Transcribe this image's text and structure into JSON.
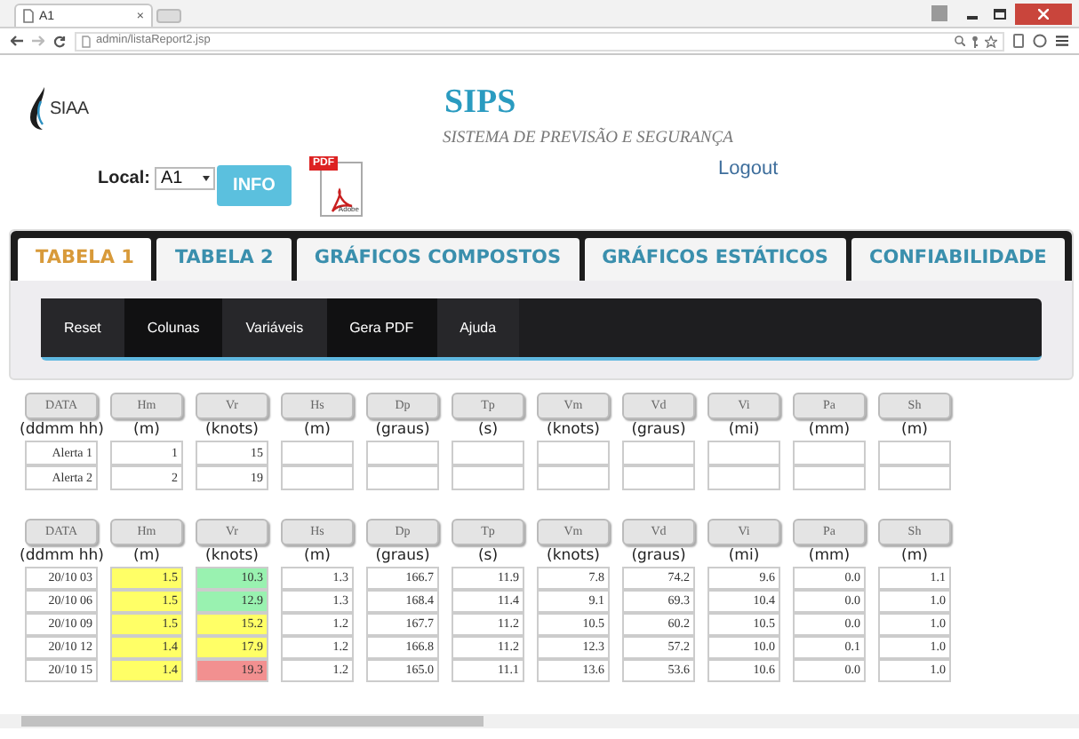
{
  "browser": {
    "tab_title": "A1",
    "tab_close": "×",
    "address": "admin/listaReport2.jsp"
  },
  "header": {
    "logo_text": "SIAA",
    "title": "SIPS",
    "subtitle": "SISTEMA DE PREVISÃO E SEGURANÇA",
    "logout": "Logout",
    "local_label": "Local:",
    "local_value": "A1",
    "info_button": "INFO",
    "pdf_label": "PDF",
    "pdf_brand": "Adobe"
  },
  "tabs": [
    {
      "label": "TABELA 1",
      "selected": true
    },
    {
      "label": "TABELA 2",
      "selected": false
    },
    {
      "label": "GRÁFICOS COMPOSTOS",
      "selected": false
    },
    {
      "label": "GRÁFICOS ESTÁTICOS",
      "selected": false
    },
    {
      "label": "CONFIABILIDADE",
      "selected": false
    }
  ],
  "menu": [
    "Reset",
    "Colunas",
    "Variáveis",
    "Gera PDF",
    "Ajuda"
  ],
  "tables": [
    {
      "columns": [
        {
          "name": "DATA",
          "unit": "(ddmm hh)"
        },
        {
          "name": "Hm",
          "unit": "(m)"
        },
        {
          "name": "Vr",
          "unit": "(knots)"
        },
        {
          "name": "Hs",
          "unit": "(m)"
        },
        {
          "name": "Dp",
          "unit": "(graus)"
        },
        {
          "name": "Tp",
          "unit": "(s)"
        },
        {
          "name": "Vm",
          "unit": "(knots)"
        },
        {
          "name": "Vd",
          "unit": "(graus)"
        },
        {
          "name": "Vi",
          "unit": "(mi)"
        },
        {
          "name": "Pa",
          "unit": "(mm)"
        },
        {
          "name": "Sh",
          "unit": "(m)"
        }
      ],
      "rows": [
        {
          "cells": [
            {
              "text": "Alerta 1"
            },
            {
              "text": "1"
            },
            {
              "text": "15"
            },
            {
              "text": ""
            },
            {
              "text": ""
            },
            {
              "text": ""
            },
            {
              "text": ""
            },
            {
              "text": ""
            },
            {
              "text": ""
            },
            {
              "text": ""
            },
            {
              "text": ""
            }
          ]
        },
        {
          "cells": [
            {
              "text": "Alerta 2"
            },
            {
              "text": "2"
            },
            {
              "text": "19"
            },
            {
              "text": ""
            },
            {
              "text": ""
            },
            {
              "text": ""
            },
            {
              "text": ""
            },
            {
              "text": ""
            },
            {
              "text": ""
            },
            {
              "text": ""
            },
            {
              "text": ""
            }
          ]
        }
      ]
    },
    {
      "columns": [
        {
          "name": "DATA",
          "unit": "(ddmm hh)"
        },
        {
          "name": "Hm",
          "unit": "(m)"
        },
        {
          "name": "Vr",
          "unit": "(knots)"
        },
        {
          "name": "Hs",
          "unit": "(m)"
        },
        {
          "name": "Dp",
          "unit": "(graus)"
        },
        {
          "name": "Tp",
          "unit": "(s)"
        },
        {
          "name": "Vm",
          "unit": "(knots)"
        },
        {
          "name": "Vd",
          "unit": "(graus)"
        },
        {
          "name": "Vi",
          "unit": "(mi)"
        },
        {
          "name": "Pa",
          "unit": "(mm)"
        },
        {
          "name": "Sh",
          "unit": "(m)"
        }
      ],
      "rows": [
        {
          "cells": [
            {
              "text": "20/10 03"
            },
            {
              "text": "1.5",
              "color": "#ffff66"
            },
            {
              "text": "10.3",
              "color": "#99f2b0"
            },
            {
              "text": "1.3"
            },
            {
              "text": "166.7"
            },
            {
              "text": "11.9"
            },
            {
              "text": "7.8"
            },
            {
              "text": "74.2"
            },
            {
              "text": "9.6"
            },
            {
              "text": "0.0"
            },
            {
              "text": "1.1"
            }
          ]
        },
        {
          "cells": [
            {
              "text": "20/10 06"
            },
            {
              "text": "1.5",
              "color": "#ffff66"
            },
            {
              "text": "12.9",
              "color": "#99f2b0"
            },
            {
              "text": "1.3"
            },
            {
              "text": "168.4"
            },
            {
              "text": "11.4"
            },
            {
              "text": "9.1"
            },
            {
              "text": "69.3"
            },
            {
              "text": "10.4"
            },
            {
              "text": "0.0"
            },
            {
              "text": "1.0"
            }
          ]
        },
        {
          "cells": [
            {
              "text": "20/10 09"
            },
            {
              "text": "1.5",
              "color": "#ffff66"
            },
            {
              "text": "15.2",
              "color": "#ffff66"
            },
            {
              "text": "1.2"
            },
            {
              "text": "167.7"
            },
            {
              "text": "11.2"
            },
            {
              "text": "10.5"
            },
            {
              "text": "60.2"
            },
            {
              "text": "10.5"
            },
            {
              "text": "0.0"
            },
            {
              "text": "1.0"
            }
          ]
        },
        {
          "cells": [
            {
              "text": "20/10 12"
            },
            {
              "text": "1.4",
              "color": "#ffff66"
            },
            {
              "text": "17.9",
              "color": "#ffff66"
            },
            {
              "text": "1.2"
            },
            {
              "text": "166.8"
            },
            {
              "text": "11.2"
            },
            {
              "text": "12.3"
            },
            {
              "text": "57.2"
            },
            {
              "text": "10.0"
            },
            {
              "text": "0.1"
            },
            {
              "text": "1.0"
            }
          ]
        },
        {
          "cells": [
            {
              "text": "20/10 15"
            },
            {
              "text": "1.4",
              "color": "#ffff66"
            },
            {
              "text": "19.3",
              "color": "#f29090"
            },
            {
              "text": "1.2"
            },
            {
              "text": "165.0"
            },
            {
              "text": "11.1"
            },
            {
              "text": "13.6"
            },
            {
              "text": "53.6"
            },
            {
              "text": "10.6"
            },
            {
              "text": "0.0"
            },
            {
              "text": "1.0"
            }
          ]
        }
      ]
    }
  ]
}
